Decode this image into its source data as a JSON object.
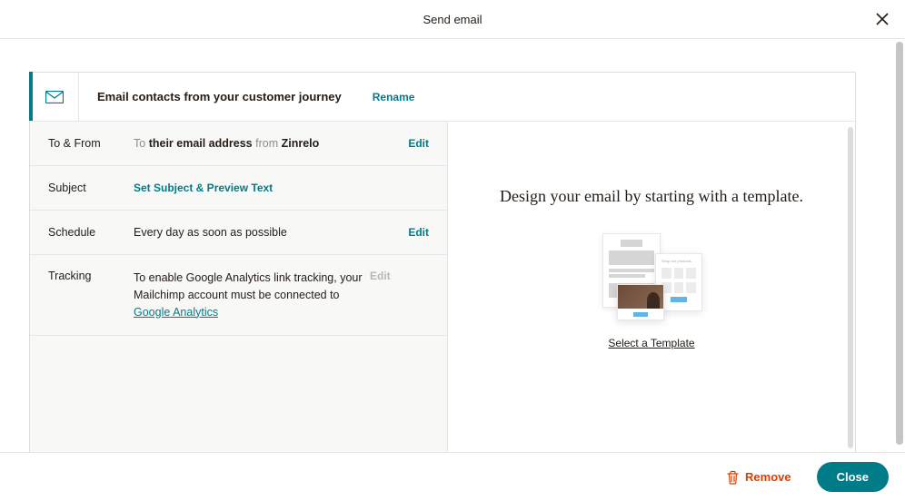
{
  "header": {
    "title": "Send email"
  },
  "panel": {
    "title": "Email contacts from your customer journey",
    "rename": "Rename"
  },
  "rows": {
    "toFrom": {
      "label": "To & From",
      "to_prefix": "To ",
      "to_value": "their email address",
      "from_prefix": " from ",
      "from_value": "Zinrelo",
      "action": "Edit"
    },
    "subject": {
      "label": "Subject",
      "link": "Set Subject & Preview Text"
    },
    "schedule": {
      "label": "Schedule",
      "value": "Every day as soon as possible",
      "action": "Edit"
    },
    "tracking": {
      "label": "Tracking",
      "text_before": "To enable Google Analytics link tracking, your Mailchimp account must be connected to ",
      "link_text": "Google Analytics",
      "action": "Edit"
    }
  },
  "right": {
    "heading": "Design your email by starting with a template.",
    "select": "Select a Template"
  },
  "footer": {
    "remove": "Remove",
    "close": "Close"
  }
}
